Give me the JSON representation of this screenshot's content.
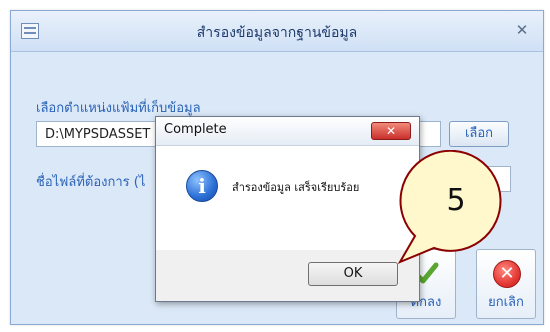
{
  "window": {
    "title": "สำรองข้อมูลจากฐานข้อมูล",
    "close_glyph": "✕"
  },
  "form": {
    "folder_label": "เลือกตำแหน่งแฟ้มที่เก็บข้อมูล",
    "folder_value": "D:\\MYPSDASSET",
    "browse_label": "เลือก",
    "filename_label": "ชื่อไฟล์ที่ต้องการ (ไ"
  },
  "buttons": {
    "ok_label": "ตกลง",
    "cancel_label": "ยกเลิก"
  },
  "message_box": {
    "title": "Complete",
    "close_glyph": "✕",
    "icon_glyph": "i",
    "message": "สำรองข้อมูล เสร็จเรียบร้อย",
    "ok_label": "OK"
  },
  "annotation": {
    "step_number": "5",
    "color": "#8b0000",
    "fill": "#fff8cc"
  },
  "icons": [
    "app-icon",
    "close-icon",
    "info-icon",
    "checkmark-icon",
    "cancel-icon"
  ]
}
